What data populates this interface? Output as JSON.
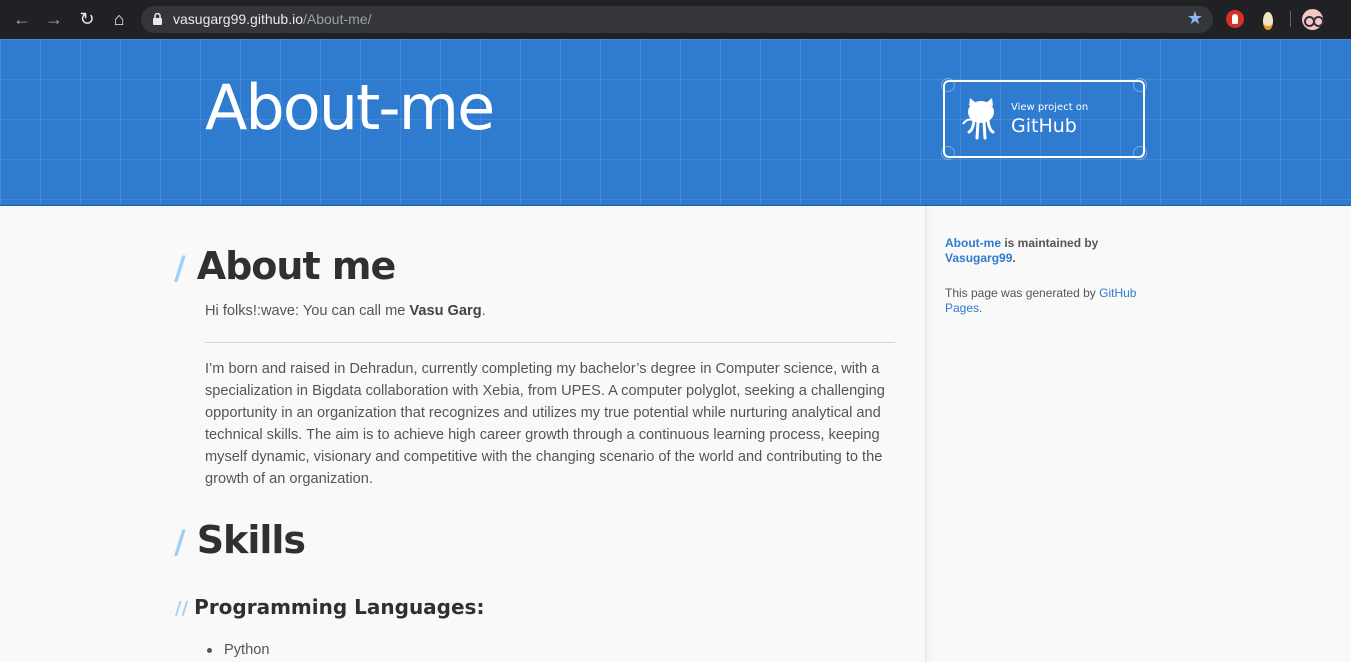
{
  "browser": {
    "url_host": "vasugarg99.github.io",
    "url_path": "/About-me/"
  },
  "header": {
    "title": "About-me",
    "github_small": "View project on",
    "github_big": "GitHub"
  },
  "main": {
    "heading_about": "About me",
    "intro_prefix": "Hi folks!:wave: You can call me ",
    "intro_name": "Vasu Garg",
    "intro_suffix": ".",
    "bio": "I’m born and raised in Dehradun, currently completing my bachelor’s degree in Computer science, with a specialization in Bigdata collaboration with Xebia, from UPES. A computer polyglot, seeking a challenging opportunity in an organization that recognizes and utilizes my true potential while nurturing analytical and technical skills. The aim is to achieve high career growth through a continuous learning process, keeping myself dynamic, visionary and competitive with the changing scenario of the world and contributing to the growth of an organization.",
    "heading_skills": "Skills",
    "heading_languages": "Programming Languages:",
    "languages": [
      "Python"
    ]
  },
  "sidebar": {
    "repo_link": "About-me",
    "maintained_text": " is maintained by ",
    "owner_link": "Vasugarg99",
    "period": ".",
    "generated_text": "This page was generated by ",
    "pages_link": "GitHub Pages",
    "period2": "."
  },
  "colors": {
    "header_blue": "#2e7bcf",
    "link_blue": "#2e7bcf",
    "slash_blue": "#9fd1f5"
  }
}
